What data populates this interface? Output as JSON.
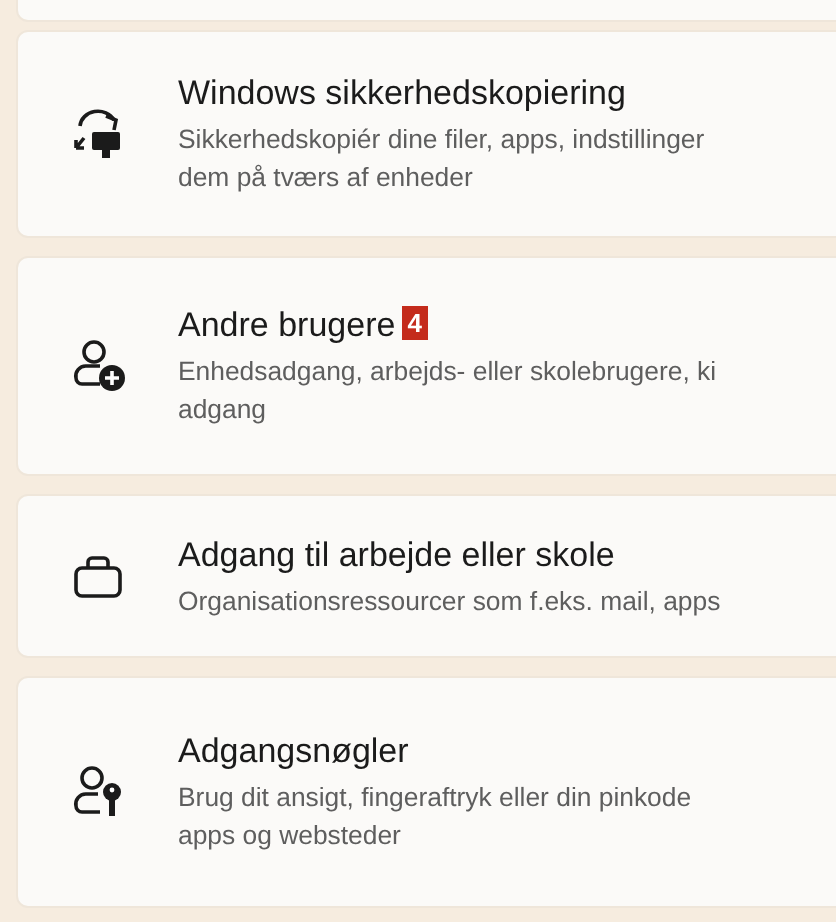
{
  "items": [
    {
      "kind": "backup",
      "title": "Windows sikkerhedskopiering",
      "description_lines": [
        "Sikkerhedskopiér dine filer, apps, indstillinger",
        "dem på tværs af enheder"
      ]
    },
    {
      "kind": "users",
      "title": "Andre brugere",
      "badge": "4",
      "description_lines": [
        "Enhedsadgang, arbejds- eller skolebrugere, ki",
        "adgang"
      ]
    },
    {
      "kind": "work",
      "title": "Adgang til arbejde eller skole",
      "description_lines": [
        "Organisationsressourcer som f.eks. mail, apps"
      ]
    },
    {
      "kind": "passkey",
      "title": "Adgangsnøgler",
      "description_lines": [
        "Brug dit ansigt, fingeraftryk eller din pinkode",
        "apps og websteder"
      ]
    }
  ]
}
